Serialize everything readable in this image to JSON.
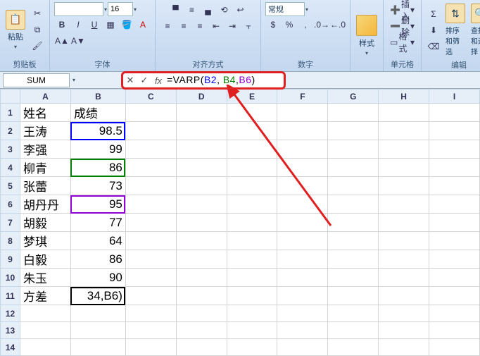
{
  "ribbon": {
    "clipboard": {
      "paste": "粘贴",
      "label": "剪贴板"
    },
    "font": {
      "name": "",
      "size": "16",
      "bold": "B",
      "italic": "I",
      "underline": "U",
      "label": "字体"
    },
    "align": {
      "label": "对齐方式"
    },
    "number": {
      "format": "常规",
      "pct": "%",
      "comma": ",",
      "label": "数字"
    },
    "styles": {
      "btn": "样式",
      "label": ""
    },
    "cells": {
      "insert": "插入",
      "delete": "删除",
      "format": "格式",
      "label": "单元格"
    },
    "editing": {
      "sigma": "Σ",
      "sort": "排序和筛选",
      "find": "查找和选择",
      "label": "编辑"
    }
  },
  "nameBox": "SUM",
  "formula": {
    "fn": "=VARP",
    "open": "(",
    "a1": "B2",
    "sep1": ",",
    "sp1": " ",
    "a2": "B4",
    "sep2": ",",
    "a3": "B6",
    "close": ")"
  },
  "cols": [
    "A",
    "B",
    "C",
    "D",
    "E",
    "F",
    "G",
    "H",
    "I"
  ],
  "rowCount": 14,
  "cells": {
    "A1": "姓名",
    "B1": "成绩",
    "A2": "王涛",
    "B2": "98.5",
    "A3": "李强",
    "B3": "99",
    "A4": "柳青",
    "B4": "86",
    "A5": "张蕾",
    "B5": "73",
    "A6": "胡丹丹",
    "B6": "95",
    "A7": "胡毅",
    "B7": "77",
    "A8": "梦琪",
    "B8": "64",
    "A9": "白毅",
    "B9": "86",
    "A10": "朱玉",
    "B10": "90",
    "A11": "方差",
    "B11": "34,B6)"
  },
  "activeCell": "B11",
  "highlights": {
    "B2": "blue",
    "B4": "green",
    "B6": "purple"
  },
  "chart_data": {
    "type": "table",
    "title": "成绩",
    "categories": [
      "王涛",
      "李强",
      "柳青",
      "张蕾",
      "胡丹丹",
      "胡毅",
      "梦琪",
      "白毅",
      "朱玉"
    ],
    "values": [
      98.5,
      99,
      86,
      73,
      95,
      77,
      64,
      86,
      90
    ],
    "xlabel": "姓名",
    "ylabel": "成绩"
  }
}
